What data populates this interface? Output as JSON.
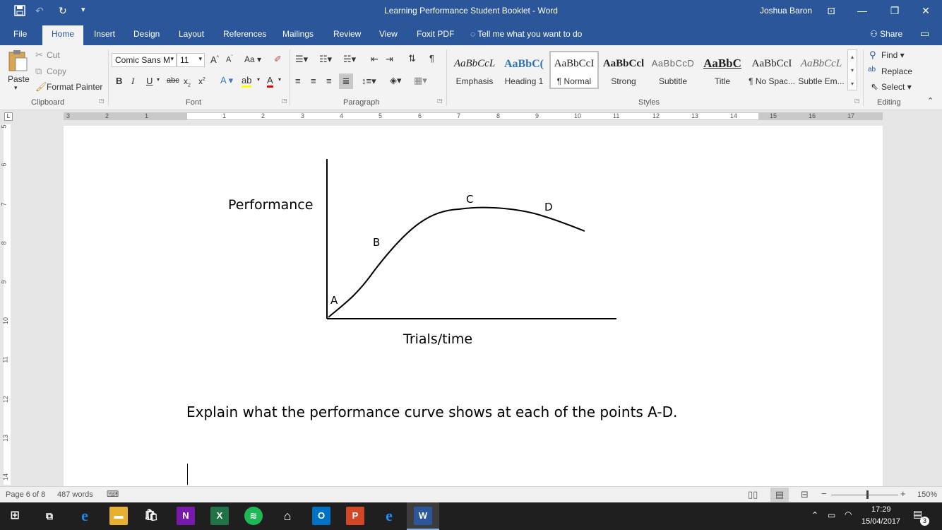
{
  "window": {
    "title": "Learning  Performance Student Booklet  -  Word",
    "user": "Joshua Baron"
  },
  "quick_access": [
    "save-icon",
    "undo-icon",
    "redo-icon",
    "customize-icon"
  ],
  "tabs": [
    "File",
    "Home",
    "Insert",
    "Design",
    "Layout",
    "References",
    "Mailings",
    "Review",
    "View",
    "Foxit PDF"
  ],
  "active_tab": "Home",
  "tell_me": "Tell me what you want to do",
  "share": "Share",
  "clipboard": {
    "paste": "Paste",
    "cut": "Cut",
    "copy": "Copy",
    "format_painter": "Format Painter",
    "label": "Clipboard"
  },
  "font": {
    "name": "Comic Sans M",
    "size": "11",
    "label": "Font",
    "case_btn": "Aa"
  },
  "paragraph": {
    "label": "Paragraph"
  },
  "styles": {
    "label": "Styles",
    "items": [
      {
        "sample": "AaBbCcL",
        "name": "Emphasis"
      },
      {
        "sample": "AaBbC(",
        "name": "Heading 1"
      },
      {
        "sample": "AaBbCcI",
        "name": "¶ Normal"
      },
      {
        "sample": "AaBbCcl",
        "name": "Strong"
      },
      {
        "sample": "AaBbCcD",
        "name": "Subtitle"
      },
      {
        "sample": "AaBbC",
        "name": "Title"
      },
      {
        "sample": "AaBbCcI",
        "name": "¶ No Spac..."
      },
      {
        "sample": "AaBbCcL",
        "name": "Subtle Em..."
      }
    ]
  },
  "editing": {
    "find": "Find",
    "replace": "Replace",
    "select": "Select",
    "label": "Editing"
  },
  "ruler": {
    "h_labels": [
      "3",
      "2",
      "1",
      "1",
      "2",
      "3",
      "4",
      "5",
      "6",
      "7",
      "8",
      "9",
      "10",
      "11",
      "12",
      "13",
      "14",
      "15",
      "16",
      "17"
    ],
    "v_labels": [
      "5",
      "6",
      "7",
      "8",
      "9",
      "10",
      "11",
      "12",
      "13",
      "14"
    ]
  },
  "diagram": {
    "y_label": "Performance",
    "x_label": "Trials/time",
    "points": [
      "A",
      "B",
      "C",
      "D"
    ]
  },
  "document": {
    "question": "Explain what the performance curve shows at each of the points A-D."
  },
  "status": {
    "page": "Page 6 of 8",
    "words": "487 words",
    "zoom": "150%"
  },
  "taskbar": {
    "time": "17:29",
    "date": "15/04/2017",
    "notifications": "3"
  }
}
